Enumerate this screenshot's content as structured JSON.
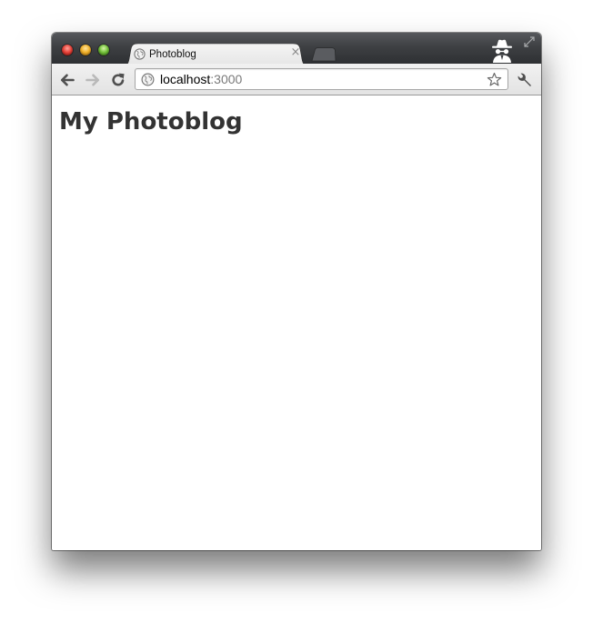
{
  "browser": {
    "tab": {
      "title": "Photoblog",
      "close_glyph": "×",
      "icon": "globe-icon"
    },
    "address_bar": {
      "host": "localhost",
      "port": ":3000",
      "site_icon": "globe-icon"
    },
    "toolbar_icons": [
      "back-arrow-icon",
      "forward-arrow-icon",
      "reload-icon",
      "star-icon",
      "wrench-icon"
    ],
    "window_icons": [
      "incognito-icon",
      "fullscreen-icon"
    ],
    "colors": {
      "frame_dark": "#3e4043",
      "tab_background": "#e8e8e8",
      "page_background": "#ffffff",
      "heading_text": "#333333",
      "traffic_close": "#e9453c",
      "traffic_minimize": "#f2b32c",
      "traffic_zoom": "#76c33d"
    }
  },
  "page": {
    "heading": "My Photoblog"
  }
}
